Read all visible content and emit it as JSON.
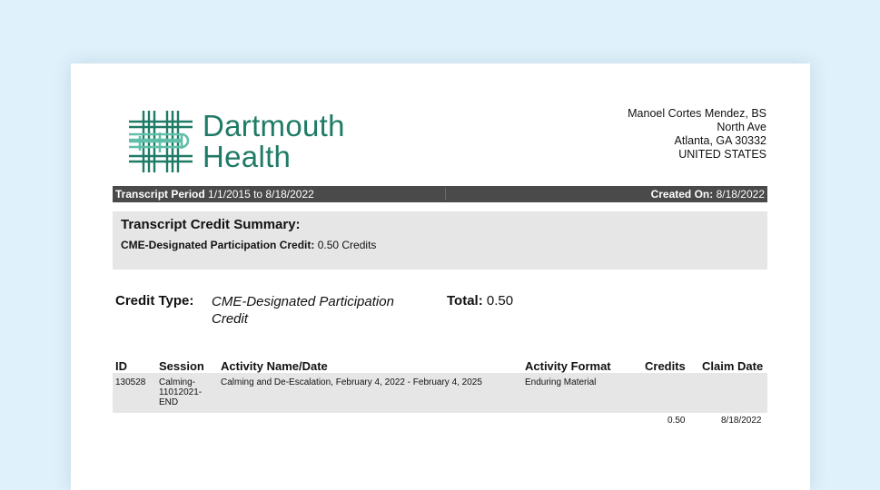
{
  "header": {
    "logo_line1": "Dartmouth",
    "logo_line2": "Health",
    "brand_color": "#1f7a66",
    "address": [
      "Manoel Cortes Mendez, BS",
      "North Ave",
      "Atlanta, GA 30332",
      "UNITED STATES"
    ]
  },
  "period": {
    "label": "Transcript Period",
    "range": "1/1/2015 to 8/18/2022",
    "created_label": "Created On:",
    "created_date": "8/18/2022"
  },
  "summary": {
    "title": "Transcript Credit Summary:",
    "credit_label": "CME-Designated Participation Credit:",
    "credit_value": "0.50 Credits"
  },
  "credit": {
    "type_label": "Credit Type:",
    "type_value": "CME-Designated Participation Credit",
    "total_label": "Total:",
    "total_value": "0.50"
  },
  "table": {
    "headers": {
      "id": "ID",
      "session": "Session",
      "activity": "Activity Name/Date",
      "format": "Activity Format",
      "credits": "Credits",
      "claim": "Claim Date"
    },
    "rows": [
      {
        "id": "130528",
        "session": [
          "Calming-",
          "11012021-",
          "END"
        ],
        "activity": "Calming and De-Escalation, February 4, 2022 - February 4, 2025",
        "format": "Enduring Material"
      }
    ],
    "totals": {
      "credits": "0.50",
      "claim": "8/18/2022"
    }
  }
}
